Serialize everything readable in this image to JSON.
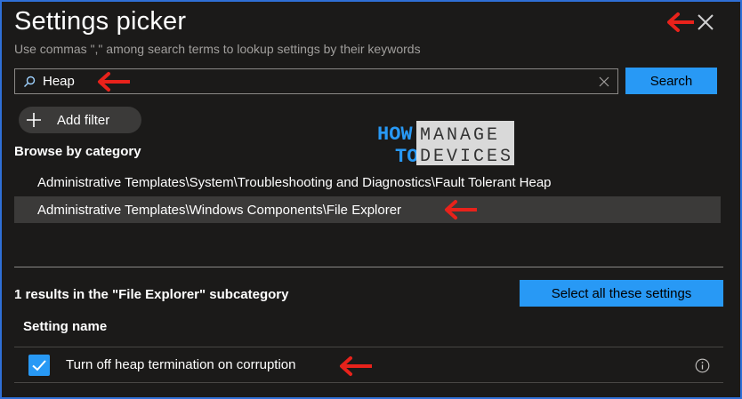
{
  "header": {
    "title": "Settings picker",
    "subtitle": "Use commas \",\" among search terms to lookup settings by their keywords"
  },
  "search": {
    "value": "Heap",
    "button_label": "Search"
  },
  "filter": {
    "add_filter_label": "Add filter"
  },
  "browse": {
    "heading": "Browse by category",
    "categories": [
      {
        "label": "Administrative Templates\\System\\Troubleshooting and Diagnostics\\Fault Tolerant Heap",
        "selected": false
      },
      {
        "label": "Administrative Templates\\Windows Components\\File Explorer",
        "selected": true
      }
    ]
  },
  "results": {
    "summary": "1 results in the \"File Explorer\" subcategory",
    "select_all_label": "Select all these settings",
    "column_header": "Setting name",
    "rows": [
      {
        "name": "Turn off heap termination on corruption",
        "checked": true
      }
    ]
  },
  "watermark": {
    "how": "HOW",
    "to": "TO",
    "manage": "MANAGE",
    "devices": "DEVICES"
  },
  "colors": {
    "accent": "#2899f5",
    "background": "#1b1a19",
    "annotation_arrow": "#e8221b",
    "frame_border": "#2f6fd6"
  },
  "icons": {
    "close": "close-icon",
    "search": "search-icon",
    "clear": "clear-icon",
    "add": "plus-icon",
    "checkbox": "checkmark-icon",
    "info": "info-icon",
    "annotation": "arrow-left-icon"
  }
}
